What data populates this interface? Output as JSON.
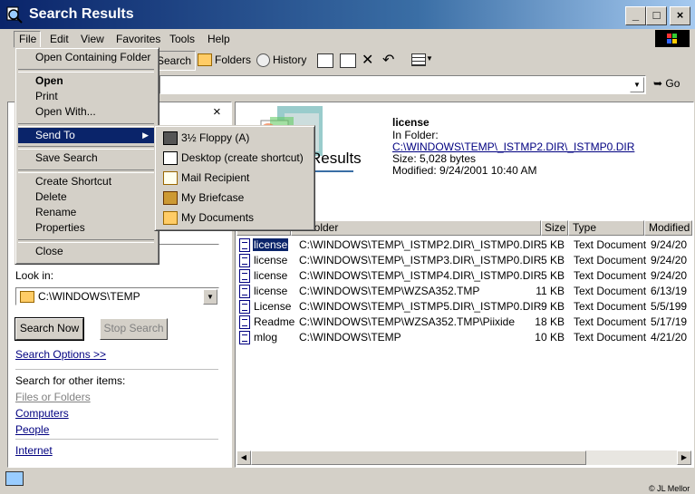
{
  "window": {
    "title": "Search Results"
  },
  "menubar": [
    "File",
    "Edit",
    "View",
    "Favorites",
    "Tools",
    "Help"
  ],
  "toolbar": {
    "search": "Search",
    "folders": "Folders",
    "history": "History"
  },
  "address": {
    "go": "Go"
  },
  "file_menu": {
    "items": [
      "Open Containing Folder",
      "Open",
      "Print",
      "Open With...",
      "Send To",
      "Save Search",
      "Create Shortcut",
      "Delete",
      "Rename",
      "Properties",
      "Close"
    ]
  },
  "sendto_menu": {
    "items": [
      "3½ Floppy (A)",
      "Desktop (create shortcut)",
      "Mail Recipient",
      "My Briefcase",
      "My Documents"
    ]
  },
  "search_panel": {
    "close": "×",
    "look_in_label": "Look in:",
    "look_in_value": "C:\\WINDOWS\\TEMP",
    "search_now": "Search Now",
    "stop_search": "Stop Search",
    "search_options": "Search Options >>",
    "other_items_label": "Search for other items:",
    "links": [
      "Files or Folders",
      "Computers",
      "People",
      "Internet"
    ]
  },
  "results": {
    "banner_title": "Results",
    "selected": {
      "name": "license",
      "in_folder_label": "In Folder:",
      "folder": "C:\\WINDOWS\\TEMP\\_ISTMP2.DIR\\_ISTMP0.DIR",
      "size": "Size: 5,028 bytes",
      "modified": "Modified: 9/24/2001 10:40 AM"
    },
    "columns": [
      "Name",
      "In Folder",
      "Size",
      "Type",
      "Modified"
    ],
    "rows": [
      {
        "name": "license",
        "folder": "C:\\WINDOWS\\TEMP\\_ISTMP2.DIR\\_ISTMP0.DIR",
        "size": "5 KB",
        "type": "Text Document",
        "modified": "9/24/20"
      },
      {
        "name": "license",
        "folder": "C:\\WINDOWS\\TEMP\\_ISTMP3.DIR\\_ISTMP0.DIR",
        "size": "5 KB",
        "type": "Text Document",
        "modified": "9/24/20"
      },
      {
        "name": "license",
        "folder": "C:\\WINDOWS\\TEMP\\_ISTMP4.DIR\\_ISTMP0.DIR",
        "size": "5 KB",
        "type": "Text Document",
        "modified": "9/24/20"
      },
      {
        "name": "license",
        "folder": "C:\\WINDOWS\\TEMP\\WZSA352.TMP",
        "size": "11 KB",
        "type": "Text Document",
        "modified": "6/13/19"
      },
      {
        "name": "License",
        "folder": "C:\\WINDOWS\\TEMP\\_ISTMP5.DIR\\_ISTMP0.DIR",
        "size": "9 KB",
        "type": "Text Document",
        "modified": "5/5/199"
      },
      {
        "name": "Readme",
        "folder": "C:\\WINDOWS\\TEMP\\WZSA352.TMP\\Piixide",
        "size": "18 KB",
        "type": "Text Document",
        "modified": "5/17/19"
      },
      {
        "name": "mlog",
        "folder": "C:\\WINDOWS\\TEMP",
        "size": "10 KB",
        "type": "Text Document",
        "modified": "4/21/20"
      }
    ]
  },
  "status": {
    "credit": "© JL Mellor"
  }
}
